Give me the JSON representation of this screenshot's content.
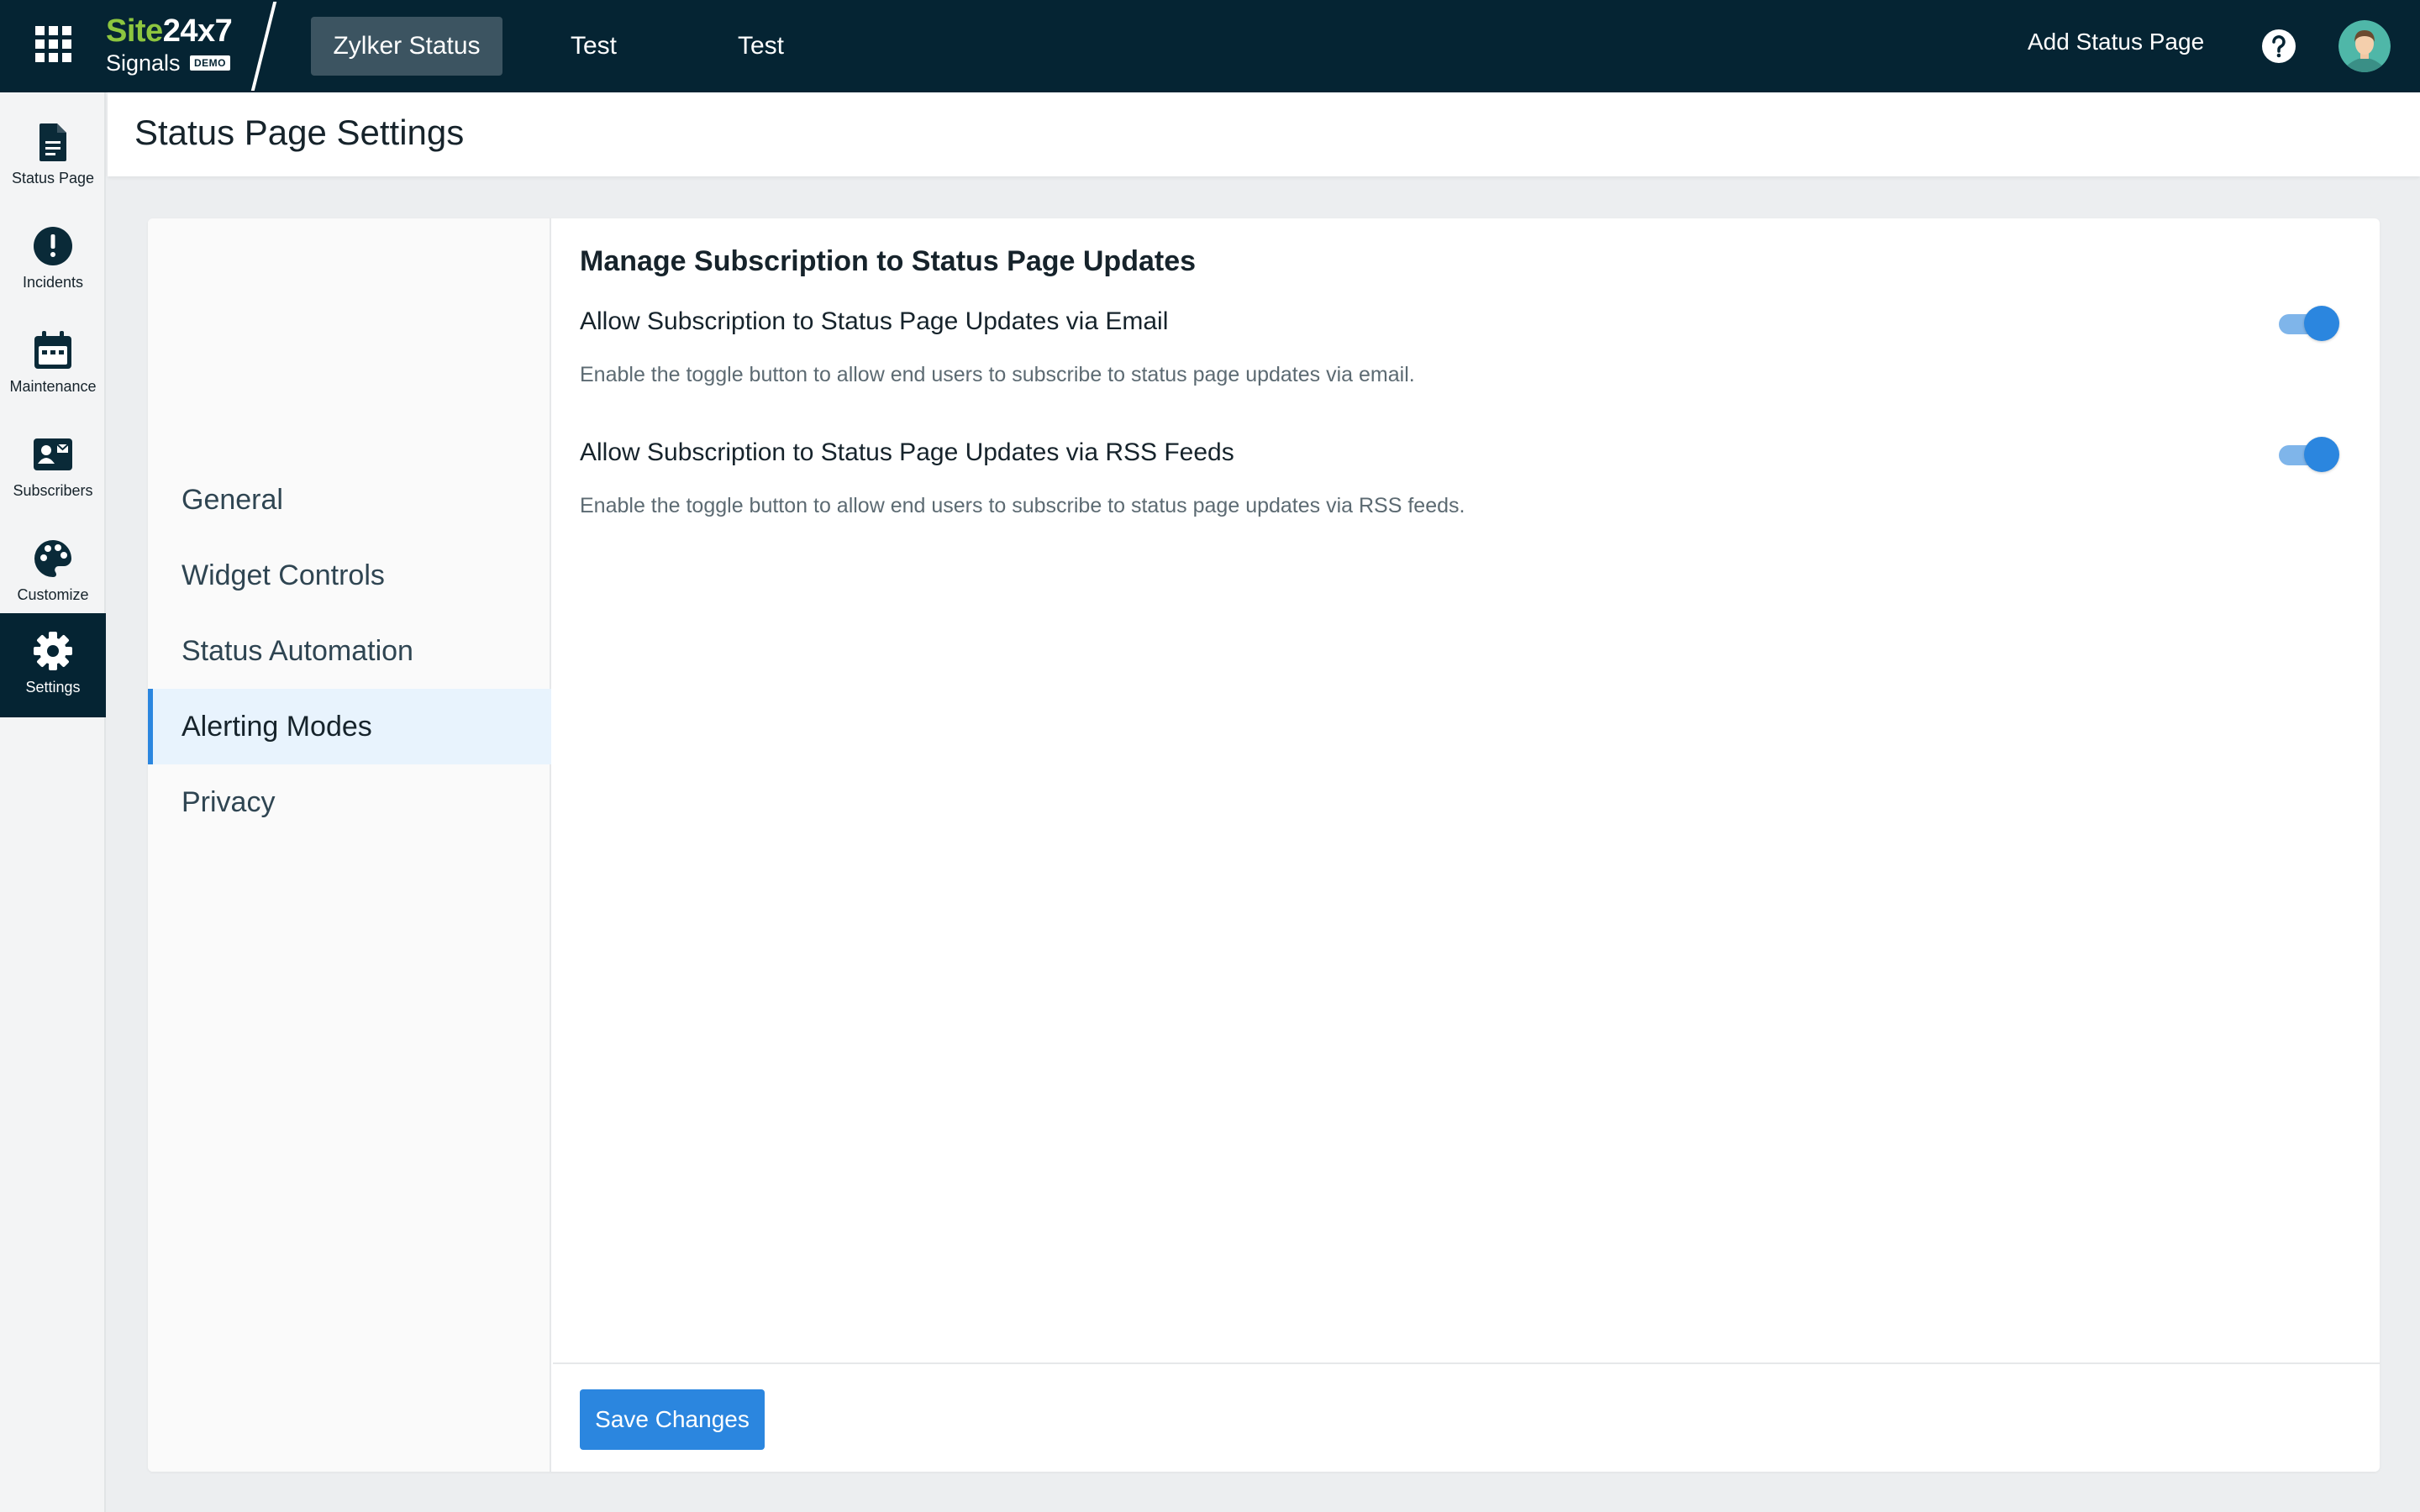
{
  "topbar": {
    "logo_site": "Site",
    "logo_num": "24x7",
    "logo_sub": "Signals",
    "logo_badge": "DEMO",
    "tabs": [
      "Zylker Status",
      "Test",
      "Test"
    ],
    "add_status_label": "Add Status Page",
    "icons": {
      "apps": "apps-grid-icon",
      "help": "help-icon",
      "avatar": "user-avatar"
    }
  },
  "rail": {
    "items": [
      {
        "label": "Status Page",
        "icon": "document-icon"
      },
      {
        "label": "Incidents",
        "icon": "alert-icon"
      },
      {
        "label": "Maintenance",
        "icon": "calendar-icon"
      },
      {
        "label": "Subscribers",
        "icon": "subscriber-card-icon"
      },
      {
        "label": "Customize",
        "icon": "palette-icon"
      },
      {
        "label": "Settings",
        "icon": "gear-icon"
      }
    ],
    "active": "Settings"
  },
  "page": {
    "title": "Status Page Settings"
  },
  "settings_nav": {
    "items": [
      "General",
      "Widget Controls",
      "Status Automation",
      "Alerting Modes",
      "Privacy"
    ],
    "active": "Alerting Modes"
  },
  "main": {
    "section_title": "Manage Subscription to Status Page Updates",
    "rows": [
      {
        "title": "Allow Subscription to Status Page Updates via Email",
        "description": "Enable the toggle button to allow end users to subscribe to status page updates via email.",
        "enabled": true
      },
      {
        "title": "Allow Subscription to Status Page Updates via RSS Feeds",
        "description": "Enable the toggle button to allow end users to subscribe to status page updates via RSS feeds.",
        "enabled": true
      }
    ],
    "save_label": "Save Changes"
  },
  "colors": {
    "topbar_bg": "#052433",
    "brand_green": "#8dc63f",
    "accent_blue": "#2b86df",
    "active_nav_bg": "#e8f3fd"
  }
}
